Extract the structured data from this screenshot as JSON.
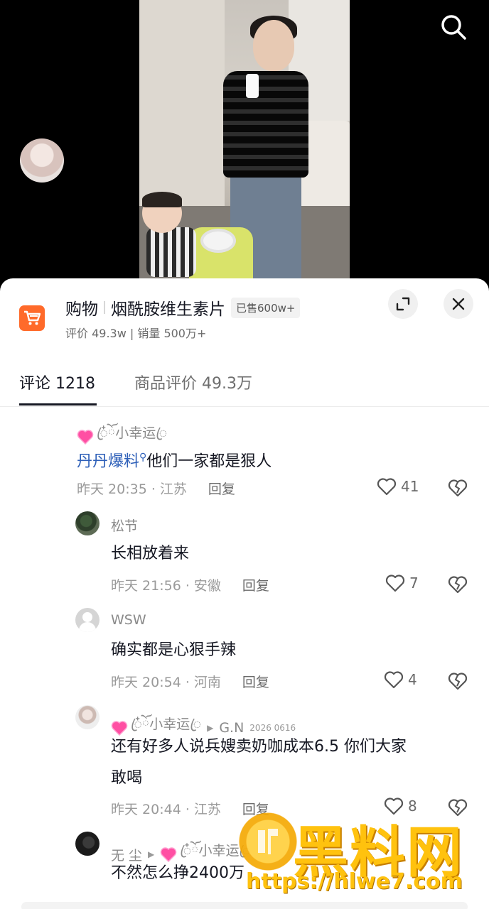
{
  "header": {
    "search_icon": "search-icon"
  },
  "product": {
    "category": "购物",
    "name": "烟酰胺维生素片",
    "sold_badge": "已售600w+",
    "stats": "评价 49.3w | 销量 500万+",
    "cart_icon": "shopping-cart-icon",
    "accent_color": "#ff6a2a"
  },
  "tabs": {
    "comments": "评论 1218",
    "reviews": "商品评价 49.3万"
  },
  "comments": [
    {
      "username": "ꦿ໋ོ小幸运ꦿ",
      "mention": "丹丹爆料",
      "text": "他们一家都是狠人",
      "time": "昨天 20:35 · 江苏",
      "reply": "回复",
      "likes": "41"
    },
    {
      "username": "松节",
      "text": "长相放着来",
      "time": "昨天 21:56 · 安徽",
      "reply": "回复",
      "likes": "7"
    },
    {
      "username": "WSW",
      "text": "确实都是心狠手辣",
      "time": "昨天 20:54 · 河南",
      "reply": "回复",
      "likes": "4"
    },
    {
      "username": "ꦿ໋ོ小幸运ꦿ",
      "reply_to": "G.N",
      "reply_to_tag": "2026  0616",
      "text_line1": "还有好多人说兵嫂卖奶咖成本6.5 你们大家",
      "text_line2": "敢喝",
      "time": "昨天 20:44 · 江苏",
      "reply": "回复",
      "likes": "8"
    },
    {
      "username": "无 尘",
      "reply_to": "ꦿ໋ོ小幸运ꦿ",
      "text": "不然怎么挣2400万"
    }
  ],
  "watermark": {
    "title": "黑料网",
    "url": "https://hlwe7.com"
  }
}
